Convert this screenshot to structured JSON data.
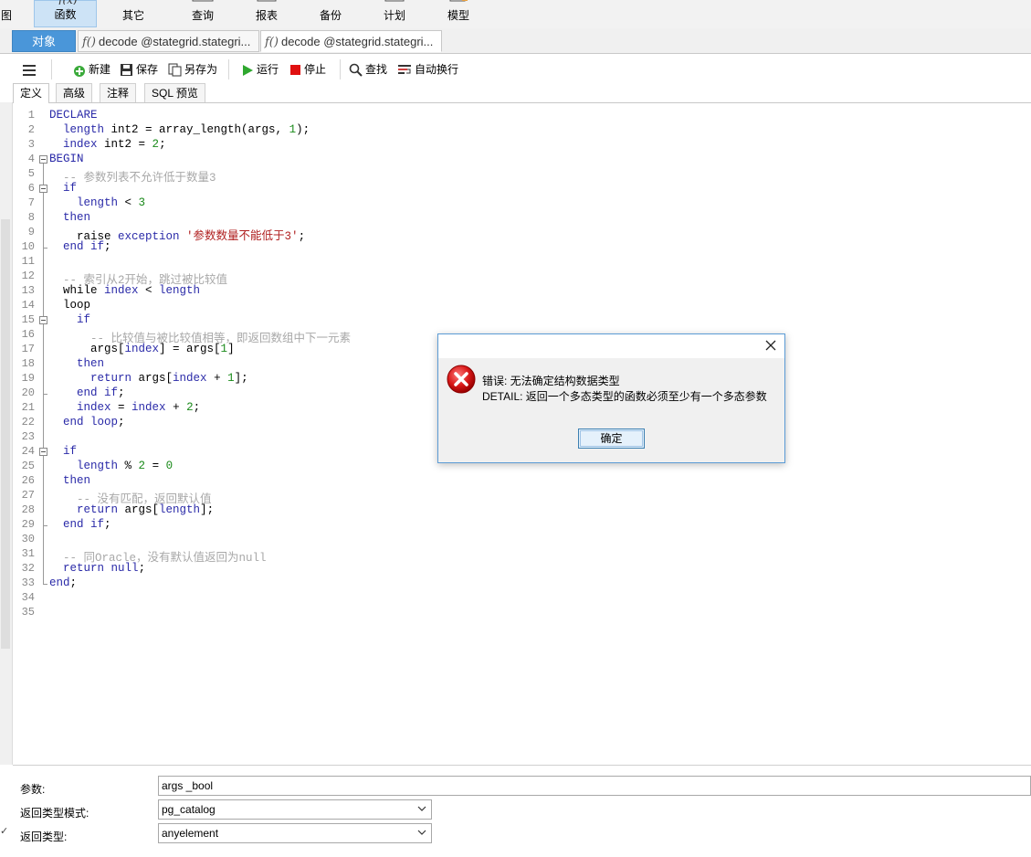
{
  "ribbon": {
    "items": [
      {
        "label": "图"
      },
      {
        "label": "函数"
      },
      {
        "label": "其它"
      },
      {
        "label": "查询"
      },
      {
        "label": "报表"
      },
      {
        "label": "备份"
      },
      {
        "label": "计划"
      },
      {
        "label": "模型"
      }
    ]
  },
  "tabs": {
    "object_label": "对象",
    "doc_tabs": [
      {
        "label": "decode @stategrid.stategri..."
      },
      {
        "label": "decode @stategrid.stategri..."
      }
    ]
  },
  "toolbar": {
    "new_label": "新建",
    "save_label": "保存",
    "save_as_label": "另存为",
    "run_label": "运行",
    "stop_label": "停止",
    "find_label": "查找",
    "wrap_label": "自动换行"
  },
  "subtabs": {
    "items": [
      {
        "label": "定义"
      },
      {
        "label": "高级"
      },
      {
        "label": "注释"
      },
      {
        "label": "SQL 预览"
      }
    ]
  },
  "editor": {
    "line_numbers": [
      "1",
      "2",
      "3",
      "4",
      "5",
      "6",
      "7",
      "8",
      "9",
      "10",
      "11",
      "12",
      "13",
      "14",
      "15",
      "16",
      "17",
      "18",
      "19",
      "20",
      "21",
      "22",
      "23",
      "24",
      "25",
      "26",
      "27",
      "28",
      "29",
      "30",
      "31",
      "32",
      "33",
      "34",
      "35"
    ],
    "lines": [
      {
        "tokens": [
          {
            "t": "DECLARE",
            "c": "kw"
          }
        ]
      },
      {
        "tokens": [
          {
            "t": "  "
          },
          {
            "t": "length",
            "c": "kw"
          },
          {
            "t": " int2 = array_length(args, "
          },
          {
            "t": "1",
            "c": "num"
          },
          {
            "t": ");"
          }
        ]
      },
      {
        "tokens": [
          {
            "t": "  "
          },
          {
            "t": "index",
            "c": "kw"
          },
          {
            "t": " int2 = "
          },
          {
            "t": "2",
            "c": "num"
          },
          {
            "t": ";"
          }
        ]
      },
      {
        "tokens": [
          {
            "t": "BEGIN",
            "c": "kw"
          }
        ]
      },
      {
        "tokens": [
          {
            "t": "  "
          },
          {
            "t": "-- 参数列表不允许低于数量3",
            "c": "cm"
          }
        ]
      },
      {
        "tokens": [
          {
            "t": "  "
          },
          {
            "t": "if",
            "c": "kw"
          }
        ]
      },
      {
        "tokens": [
          {
            "t": "    "
          },
          {
            "t": "length",
            "c": "kw"
          },
          {
            "t": " < "
          },
          {
            "t": "3",
            "c": "num"
          }
        ]
      },
      {
        "tokens": [
          {
            "t": "  "
          },
          {
            "t": "then",
            "c": "kw"
          }
        ]
      },
      {
        "tokens": [
          {
            "t": "    raise "
          },
          {
            "t": "exception",
            "c": "kw"
          },
          {
            "t": " "
          },
          {
            "t": "'参数数量不能低于3'",
            "c": "str"
          },
          {
            "t": ";"
          }
        ]
      },
      {
        "tokens": [
          {
            "t": "  "
          },
          {
            "t": "end if",
            "c": "kw"
          },
          {
            "t": ";"
          }
        ]
      },
      {
        "tokens": []
      },
      {
        "tokens": [
          {
            "t": "  "
          },
          {
            "t": "-- 索引从2开始，跳过被比较值",
            "c": "cm"
          }
        ]
      },
      {
        "tokens": [
          {
            "t": "  while "
          },
          {
            "t": "index",
            "c": "kw"
          },
          {
            "t": " < "
          },
          {
            "t": "length",
            "c": "kw"
          }
        ]
      },
      {
        "tokens": [
          {
            "t": "  loop"
          }
        ]
      },
      {
        "tokens": [
          {
            "t": "    "
          },
          {
            "t": "if",
            "c": "kw"
          }
        ]
      },
      {
        "tokens": [
          {
            "t": "      "
          },
          {
            "t": "-- 比较值与被比较值相等，即返回数组中下一元素",
            "c": "cm"
          }
        ]
      },
      {
        "tokens": [
          {
            "t": "      args["
          },
          {
            "t": "index",
            "c": "kw"
          },
          {
            "t": "] = args["
          },
          {
            "t": "1",
            "c": "num"
          },
          {
            "t": "]"
          }
        ]
      },
      {
        "tokens": [
          {
            "t": "    "
          },
          {
            "t": "then",
            "c": "kw"
          }
        ]
      },
      {
        "tokens": [
          {
            "t": "      "
          },
          {
            "t": "return",
            "c": "kw"
          },
          {
            "t": " args["
          },
          {
            "t": "index",
            "c": "kw"
          },
          {
            "t": " + "
          },
          {
            "t": "1",
            "c": "num"
          },
          {
            "t": "];"
          }
        ]
      },
      {
        "tokens": [
          {
            "t": "    "
          },
          {
            "t": "end if",
            "c": "kw"
          },
          {
            "t": ";"
          }
        ]
      },
      {
        "tokens": [
          {
            "t": "    "
          },
          {
            "t": "index",
            "c": "kw"
          },
          {
            "t": " = "
          },
          {
            "t": "index",
            "c": "kw"
          },
          {
            "t": " + "
          },
          {
            "t": "2",
            "c": "num"
          },
          {
            "t": ";"
          }
        ]
      },
      {
        "tokens": [
          {
            "t": "  "
          },
          {
            "t": "end loop",
            "c": "kw"
          },
          {
            "t": ";"
          }
        ]
      },
      {
        "tokens": []
      },
      {
        "tokens": [
          {
            "t": "  "
          },
          {
            "t": "if",
            "c": "kw"
          }
        ]
      },
      {
        "tokens": [
          {
            "t": "    "
          },
          {
            "t": "length",
            "c": "kw"
          },
          {
            "t": " % "
          },
          {
            "t": "2",
            "c": "num"
          },
          {
            "t": " = "
          },
          {
            "t": "0",
            "c": "num"
          }
        ]
      },
      {
        "tokens": [
          {
            "t": "  "
          },
          {
            "t": "then",
            "c": "kw"
          }
        ]
      },
      {
        "tokens": [
          {
            "t": "    "
          },
          {
            "t": "-- 没有匹配，返回默认值",
            "c": "cm"
          }
        ]
      },
      {
        "tokens": [
          {
            "t": "    "
          },
          {
            "t": "return",
            "c": "kw"
          },
          {
            "t": " args["
          },
          {
            "t": "length",
            "c": "kw"
          },
          {
            "t": "];"
          }
        ]
      },
      {
        "tokens": [
          {
            "t": "  "
          },
          {
            "t": "end if",
            "c": "kw"
          },
          {
            "t": ";"
          }
        ]
      },
      {
        "tokens": []
      },
      {
        "tokens": [
          {
            "t": "  "
          },
          {
            "t": "-- 同Oracle，没有默认值返回为null",
            "c": "cm"
          }
        ]
      },
      {
        "tokens": [
          {
            "t": "  "
          },
          {
            "t": "return",
            "c": "kw"
          },
          {
            "t": " "
          },
          {
            "t": "null",
            "c": "kw"
          },
          {
            "t": ";"
          }
        ]
      },
      {
        "tokens": [
          {
            "t": "end",
            "c": "kw"
          },
          {
            "t": ";"
          }
        ]
      },
      {
        "tokens": []
      },
      {
        "tokens": []
      }
    ]
  },
  "params": {
    "params_label": "参数:",
    "params_value": "args _bool",
    "return_schema_label": "返回类型模式:",
    "return_schema_value": "pg_catalog",
    "return_type_label": "返回类型:",
    "return_type_value": "anyelement"
  },
  "dialog": {
    "line1": "错误:  无法确定结构数据类型",
    "line2": "DETAIL:  返回一个多态类型的函数必须至少有一个多态参数",
    "ok_label": "确定"
  },
  "colors": {
    "keyword": "#2a2aa8",
    "comment": "#a8a8a8",
    "number": "#1a8a1a",
    "string": "#b02020",
    "accent": "#4a96d9"
  }
}
